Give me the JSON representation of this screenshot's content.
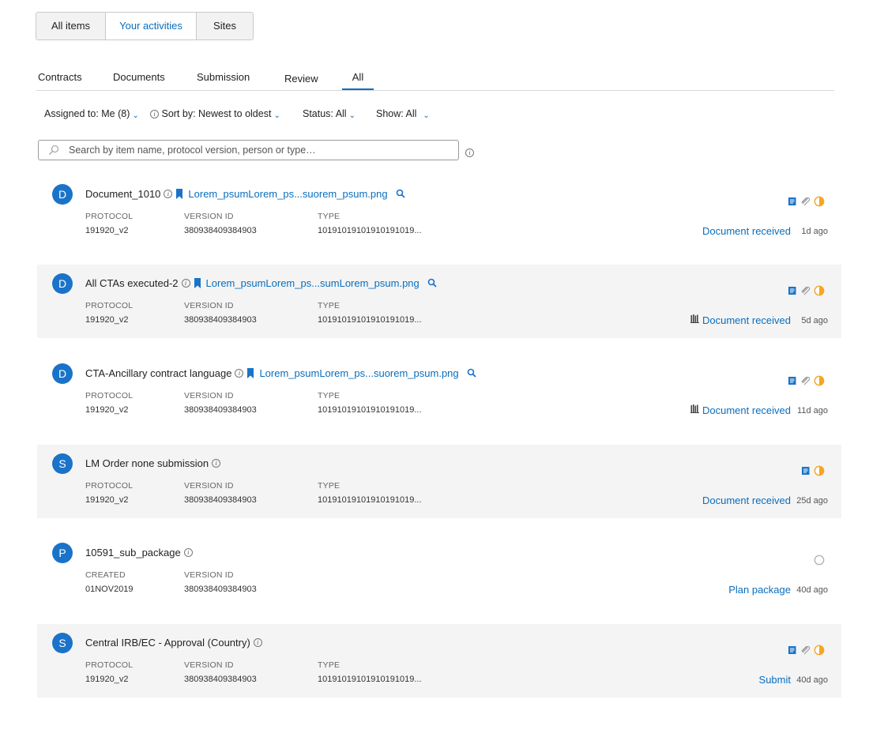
{
  "top_tabs": [
    {
      "label": "All items",
      "active": false
    },
    {
      "label": "Your activities",
      "active": true
    },
    {
      "label": "Sites",
      "active": false
    }
  ],
  "sub_tabs": [
    {
      "label": "Contracts",
      "active": false
    },
    {
      "label": "Documents",
      "active": false
    },
    {
      "label": "Submission",
      "active": false
    },
    {
      "label": "Review",
      "active": false
    },
    {
      "label": "All",
      "active": true
    }
  ],
  "filters": {
    "assigned": "Assigned to: Me (8)",
    "sort": "Sort by: Newest to oldest",
    "status": "Status: All",
    "show": "Show: All"
  },
  "search": {
    "placeholder": "Search by item name, protocol version, person or type…",
    "value": ""
  },
  "colors": {
    "accent": "#0a6ebd",
    "avatar": "#1a73c8",
    "row_shade": "#f4f4f4",
    "status_half": "#f5a623"
  },
  "labels": {
    "protocol": "PROTOCOL",
    "version_id": "VERSION ID",
    "type": "TYPE",
    "created": "CREATED"
  },
  "items": [
    {
      "avatar": "D",
      "title": "Document_1010",
      "link": "Lorem_psumLorem_ps...suorem_psum.png",
      "protocol": "191920_v2",
      "version_id": "380938409384903",
      "type": "10191019101910191019...",
      "status": "Document received",
      "ago": "1d ago",
      "icons": [
        "document-icon",
        "attachment-icon",
        "half-circle-icon"
      ],
      "library_icon": false
    },
    {
      "avatar": "D",
      "title": "All CTAs executed-2",
      "link": "Lorem_psumLorem_ps...sumLorem_psum.png",
      "protocol": "191920_v2",
      "version_id": "380938409384903",
      "type": "10191019101910191019...",
      "status": "Document received",
      "ago": "5d ago",
      "icons": [
        "document-icon",
        "attachment-icon",
        "half-circle-icon"
      ],
      "library_icon": true
    },
    {
      "avatar": "D",
      "title": "CTA-Ancillary contract language",
      "link": "Lorem_psumLorem_ps...suorem_psum.png",
      "protocol": "191920_v2",
      "version_id": "380938409384903",
      "type": "10191019101910191019...",
      "status": "Document received",
      "ago": "11d ago",
      "icons": [
        "document-icon",
        "attachment-icon",
        "half-circle-icon"
      ],
      "library_icon": true
    },
    {
      "avatar": "S",
      "title": "LM Order none submission",
      "protocol": "191920_v2",
      "version_id": "380938409384903",
      "type": "10191019101910191019...",
      "status": "Document received",
      "ago": "25d ago",
      "icons": [
        "document-icon",
        "half-circle-icon"
      ],
      "library_icon": false
    },
    {
      "avatar": "P",
      "title": "10591_sub_package",
      "created": "01NOV2019",
      "version_id": "380938409384903",
      "status": "Plan package",
      "ago": "40d ago",
      "icons": [
        "empty-circle-icon"
      ],
      "library_icon": false
    },
    {
      "avatar": "S",
      "title": "Central IRB/EC - Approval (Country)",
      "protocol": "191920_v2",
      "version_id": "380938409384903",
      "type": "10191019101910191019...",
      "status": "Submit",
      "ago": "40d ago",
      "icons": [
        "document-icon",
        "attachment-icon",
        "half-circle-icon"
      ],
      "library_icon": false
    }
  ]
}
